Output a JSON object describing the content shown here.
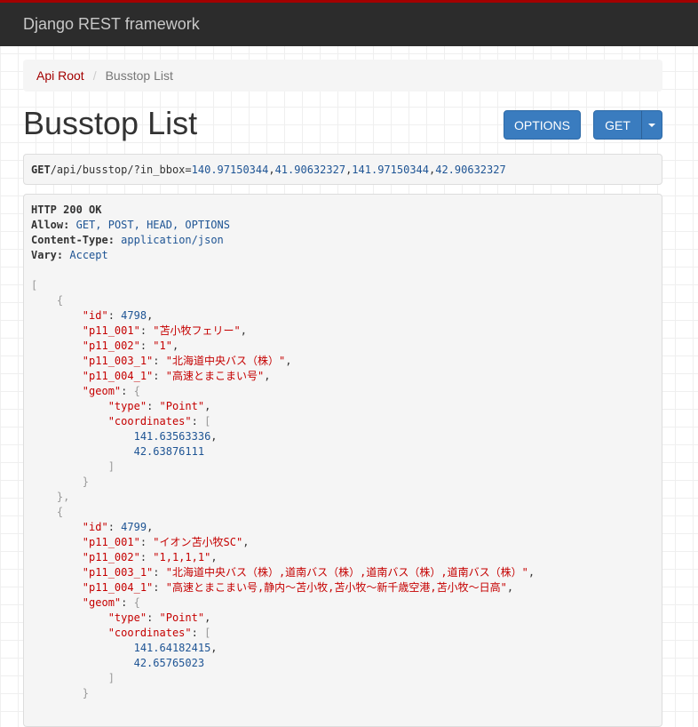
{
  "navbar": {
    "brand": "Django REST framework"
  },
  "breadcrumb": {
    "root": "Api Root",
    "separator": "/",
    "current": "Busstop List"
  },
  "page_title": "Busstop List",
  "buttons": {
    "options": "OPTIONS",
    "get": "GET"
  },
  "request": {
    "method": "GET",
    "path": "/api/busstop/?in_bbox=",
    "bbox_values": [
      "140.97150344",
      "41.90632327",
      "141.97150344",
      "42.90632327"
    ]
  },
  "response": {
    "status": "HTTP 200 OK",
    "headers": [
      {
        "key": "Allow",
        "value": "GET, POST, HEAD, OPTIONS"
      },
      {
        "key": "Content-Type",
        "value": "application/json"
      },
      {
        "key": "Vary",
        "value": "Accept"
      }
    ],
    "items": [
      {
        "id": "4798",
        "p11_001": "\"苫小牧フェリー\"",
        "p11_002": "\"1\"",
        "p11_003_1": "\"北海道中央バス（株）\"",
        "p11_004_1": "\"高速とまこまい号\"",
        "geom_type": "\"Point\"",
        "coordinates": [
          "141.63563336",
          "42.63876111"
        ]
      },
      {
        "id": "4799",
        "p11_001": "\"イオン苫小牧SC\"",
        "p11_002": "\"1,1,1,1\"",
        "p11_003_1": "\"北海道中央バス（株）,道南バス（株）,道南バス（株）,道南バス（株）\"",
        "p11_004_1": "\"高速とまこまい号,静内～苫小牧,苫小牧～新千歳空港,苫小牧～日高\"",
        "geom_type": "\"Point\"",
        "coordinates": [
          "141.64182415",
          "42.65765023"
        ]
      }
    ]
  }
}
